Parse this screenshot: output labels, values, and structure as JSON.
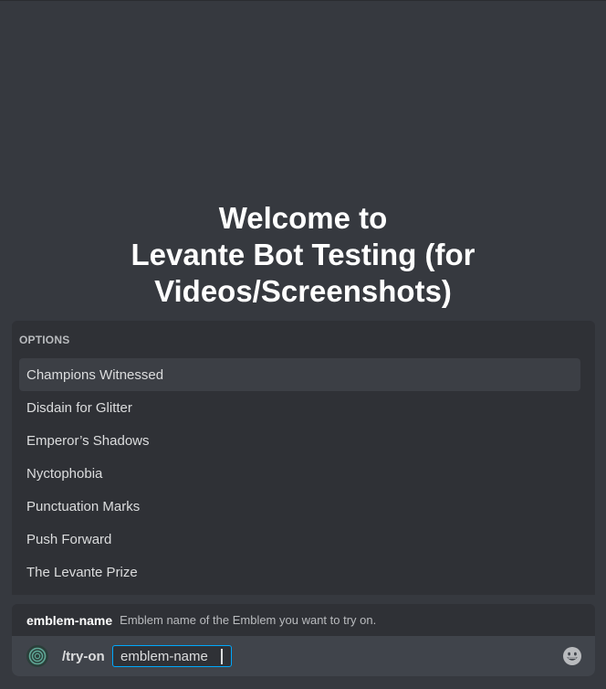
{
  "welcome": {
    "line1": "Welcome to",
    "line2": "Levante Bot Testing (for",
    "line3": "Videos/Screenshots)"
  },
  "options": {
    "header": "OPTIONS",
    "items": [
      {
        "label": "Champions Witnessed",
        "selected": true
      },
      {
        "label": "Disdain for Glitter",
        "selected": false
      },
      {
        "label": "Emperor’s Shadows",
        "selected": false
      },
      {
        "label": "Nyctophobia",
        "selected": false
      },
      {
        "label": "Punctuation Marks",
        "selected": false
      },
      {
        "label": "Push Forward",
        "selected": false
      },
      {
        "label": "The Levante Prize",
        "selected": false
      }
    ]
  },
  "param_hint": {
    "name": "emblem-name",
    "description": "Emblem name of the Emblem you want to try on."
  },
  "composer": {
    "command": "/try-on",
    "param_value": "emblem-name",
    "bot_icon": "bot-avatar-icon",
    "emoji_icon": "emoji-smile-icon"
  },
  "colors": {
    "background": "#36393f",
    "panel": "#2f3136",
    "input": "#40444b",
    "focus": "#00a8fc"
  }
}
